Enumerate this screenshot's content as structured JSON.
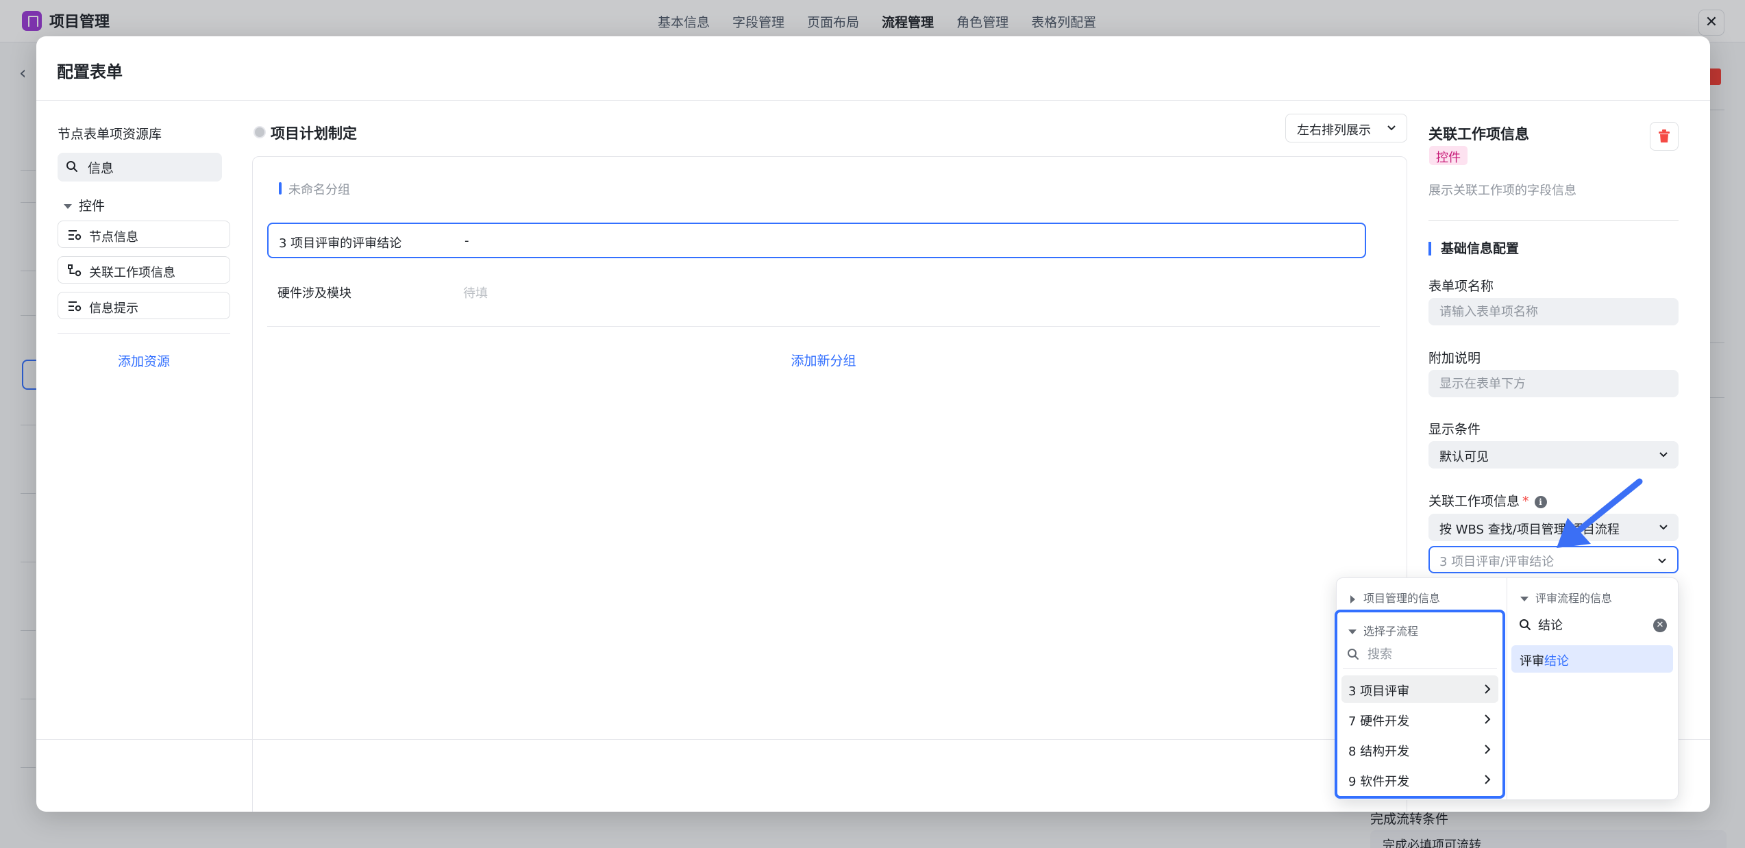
{
  "app": {
    "title": "项目管理",
    "tabs": [
      "基本信息",
      "字段管理",
      "页面布局",
      "流程管理",
      "角色管理",
      "表格列配置"
    ],
    "active_tab": "流程管理",
    "close_label": "✕",
    "background_bottom": {
      "label": "完成流转条件",
      "value": "完成必填项可流转"
    }
  },
  "modal": {
    "title": "配置表单"
  },
  "resource_library": {
    "title": "节点表单项资源库",
    "search_value": "信息",
    "group_label": "控件",
    "items": [
      {
        "label": "节点信息",
        "icon": "list-settings-icon"
      },
      {
        "label": "关联工作项信息",
        "icon": "link-node-icon"
      },
      {
        "label": "信息提示",
        "icon": "list-settings-icon"
      }
    ],
    "add_label": "添加资源"
  },
  "form_canvas": {
    "node_title": "项目计划制定",
    "layout_select": "左右排列展示",
    "group_name": "未命名分组",
    "fields": [
      {
        "label": "3 项目评审的评审结论",
        "value": "-"
      },
      {
        "label": "硬件涉及模块",
        "value": "待填"
      }
    ],
    "add_group_label": "添加新分组"
  },
  "properties": {
    "title": "关联工作项信息",
    "tag": "控件",
    "description": "展示关联工作项的字段信息",
    "section_title": "基础信息配置",
    "name_label": "表单项名称",
    "name_placeholder": "请输入表单项名称",
    "note_label": "附加说明",
    "note_placeholder": "显示在表单下方",
    "condition_label": "显示条件",
    "condition_value": "默认可见",
    "related_label": "关联工作项信息",
    "required_mark": "*",
    "info_glyph": "i",
    "related_source_value": "按 WBS 查找/项目管理/项目流程",
    "related_field_value": "3 项目评审/评审结论"
  },
  "cascader": {
    "left_header": "项目管理的信息",
    "sub_header": "选择子流程",
    "sub_search_placeholder": "搜索",
    "sub_items": [
      "3 项目评审",
      "7 硬件开发",
      "8 结构开发",
      "9 软件开发"
    ],
    "right_header": "评审流程的信息",
    "right_search_value": "结论",
    "result_prefix": "评审",
    "result_highlight": "结论"
  },
  "colors": {
    "accent": "#3370ff",
    "danger": "#f54a45",
    "tag_bg": "#fde2f0",
    "tag_text": "#c71a78",
    "logo": "#9b3bd6"
  }
}
